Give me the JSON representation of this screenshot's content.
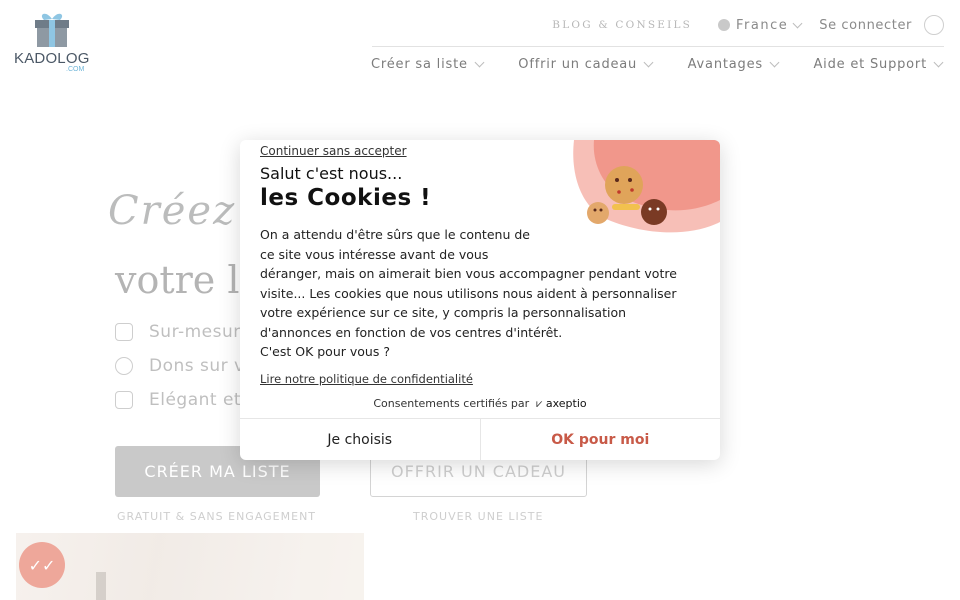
{
  "header": {
    "logo_text": "KADOLOG",
    "logo_suffix": ".COM",
    "blog_label": "BLOG & CONSEILS",
    "country_label": "France",
    "login_label": "Se connecter"
  },
  "nav": {
    "items": [
      {
        "label": "Créer sa liste"
      },
      {
        "label": "Offrir un cadeau"
      },
      {
        "label": "Avantages"
      },
      {
        "label": "Aide et Support"
      }
    ]
  },
  "hero": {
    "script_text": "Créez",
    "title": "votre li",
    "features": [
      {
        "label": "Sur-mesur",
        "icon": "tag-icon"
      },
      {
        "label": "Dons sur v",
        "icon": "piggy-bank-icon"
      },
      {
        "label": "Elégant et",
        "icon": "shopping-bag-icon"
      }
    ],
    "create_button": "CRÉER MA LISTE",
    "create_sub": "GRATUIT & SANS ENGAGEMENT",
    "offer_button": "OFFRIR UN CADEAU",
    "offer_sub": "TROUVER UNE LISTE"
  },
  "cookie_dialog": {
    "continue_link": "Continuer sans accepter",
    "greeting": "Salut c'est nous...",
    "title": "les Cookies !",
    "body_lines": [
      "On a attendu d'être sûrs que le contenu de",
      "ce site vous intéresse avant de vous",
      "déranger, mais on aimerait bien vous accompagner pendant votre",
      "visite... Les cookies que nous utilisons nous aident à personnaliser",
      "votre expérience sur ce site, y compris la personnalisation",
      "d'annonces en fonction de vos centres d'intérêt.",
      "C'est OK pour vous ?"
    ],
    "policy_link": "Lire notre politique de confidentialité",
    "certified_text": "Consentements certifiés par",
    "certified_brand": "axeptio",
    "choose_button": "Je choisis",
    "accept_button": "OK pour moi",
    "accent_color": "#c85a48"
  }
}
